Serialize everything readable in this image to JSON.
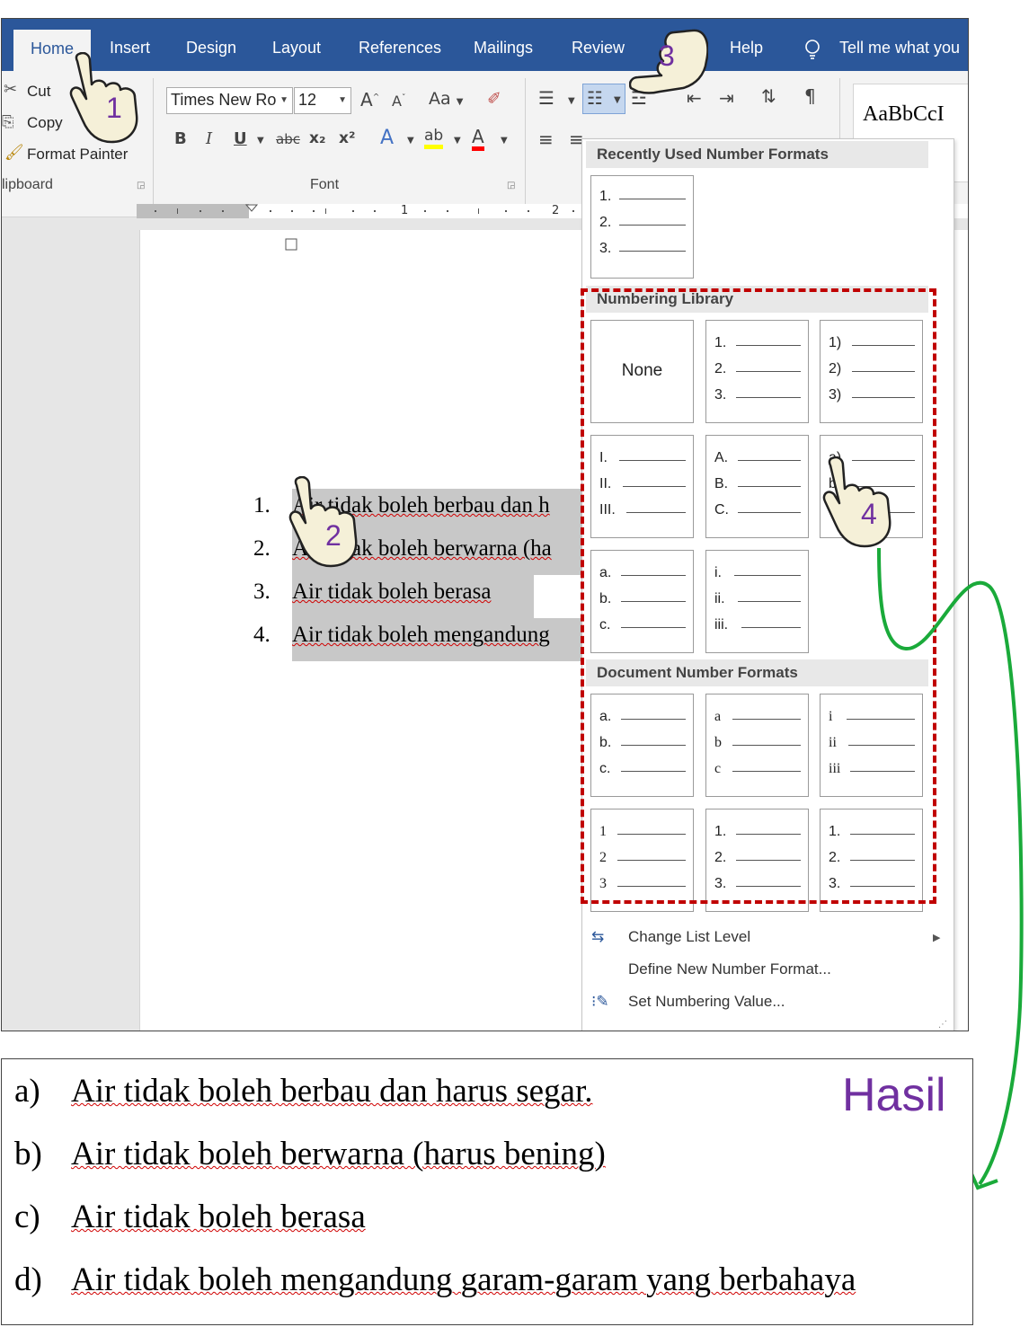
{
  "tabs": {
    "home": "Home",
    "insert": "Insert",
    "design": "Design",
    "layout": "Layout",
    "references": "References",
    "mailings": "Mailings",
    "review": "Review",
    "help": "Help",
    "tell_me": "Tell me what you"
  },
  "clipboard": {
    "cut": "Cut",
    "copy": "Copy",
    "format_painter": "Format Painter",
    "group_label": "lipboard"
  },
  "font": {
    "name": "Times New Ro",
    "size": "12",
    "group_label": "Font",
    "bold": "B",
    "italic": "I",
    "underline": "U",
    "strike": "abc",
    "subscript": "x₂",
    "superscript": "x²",
    "change_case": "Aa"
  },
  "styles": {
    "preview": "AaBbCcI"
  },
  "ruler": {
    "mark1": "1",
    "mark2": "2"
  },
  "document": {
    "list": [
      {
        "num": "1.",
        "text": "Air tidak boleh berbau dan h"
      },
      {
        "num": "2.",
        "text": "Air tidak boleh berwarna (ha"
      },
      {
        "num": "3.",
        "text": "Air tidak boleh berasa"
      },
      {
        "num": "4.",
        "text": "Air tidak boleh mengandung"
      }
    ]
  },
  "dropdown": {
    "recent_header": "Recently Used Number Formats",
    "library_header": "Numbering Library",
    "document_header": "Document Number Formats",
    "none_label": "None",
    "recent": [
      [
        "1.",
        "2.",
        "3."
      ]
    ],
    "library": [
      [
        "1.",
        "2.",
        "3."
      ],
      [
        "1)",
        "2)",
        "3)"
      ],
      [
        "I.",
        "II.",
        "III."
      ],
      [
        "A.",
        "B.",
        "C."
      ],
      [
        "a)",
        "b)",
        "c)"
      ],
      [
        "a.",
        "b.",
        "c."
      ],
      [
        "i.",
        "ii.",
        "iii."
      ]
    ],
    "document_formats": [
      [
        "a.",
        "b.",
        "c."
      ],
      [
        "a",
        "b",
        "c"
      ],
      [
        "i",
        "ii",
        "iii"
      ],
      [
        "1",
        "2",
        "3"
      ],
      [
        "1.",
        "2.",
        "3."
      ],
      [
        "1.",
        "2.",
        "3."
      ]
    ],
    "menu": {
      "change_level": "Change List Level",
      "define_new": "Define New Number Format...",
      "set_value": "Set Numbering Value..."
    }
  },
  "steps": [
    "1",
    "2",
    "3",
    "4"
  ],
  "result": {
    "label": "Hasil",
    "items": [
      {
        "label": "a)",
        "text": "Air tidak boleh berbau dan harus segar."
      },
      {
        "label": "b)",
        "text": "Air tidak boleh berwarna (harus bening)"
      },
      {
        "label": "c)",
        "text": "Air tidak boleh berasa"
      },
      {
        "label": "d)",
        "text": "Air tidak boleh mengandung garam-garam yang berbahaya"
      }
    ]
  },
  "colors": {
    "ribbon_blue": "#2b579a",
    "highlight_red": "#c00000",
    "annotation_purple": "#7030a0",
    "arrow_green": "#1aaa3a"
  }
}
